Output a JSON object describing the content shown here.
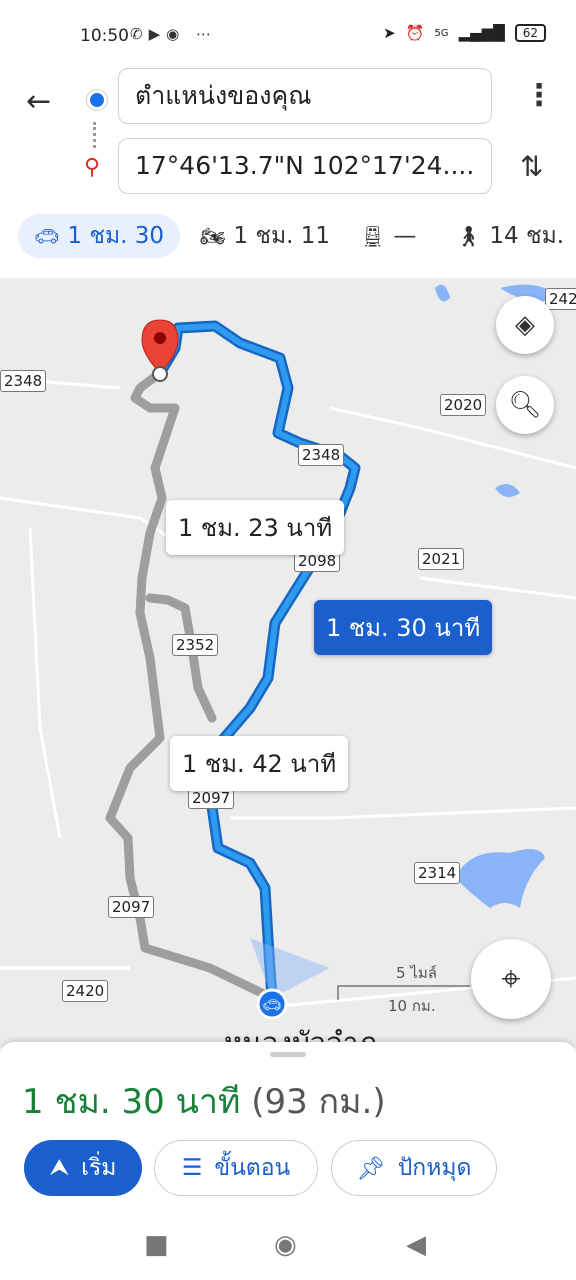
{
  "status": {
    "time": "10:50",
    "battery": "62",
    "network": "5G"
  },
  "header": {
    "origin": "ตำแหน่งของคุณ",
    "destination": "17°46'13.7\"N 102°17'24...."
  },
  "modes": [
    {
      "icon": "car-icon",
      "label": "1 ชม. 30",
      "active": true
    },
    {
      "icon": "motorcycle-icon",
      "label": "1 ชม. 11"
    },
    {
      "icon": "transit-icon",
      "label": "—"
    },
    {
      "icon": "walk-icon",
      "label": "14 ชม."
    }
  ],
  "map": {
    "road_labels": [
      "2348",
      "2020",
      "2348",
      "2021",
      "2098",
      "2352",
      "2097",
      "2314",
      "2097",
      "2420",
      "242"
    ],
    "route_times": {
      "alt1": "1 ชม. 23 นาที",
      "selected": "1 ชม. 30 นาที",
      "alt2": "1 ชม. 42 นาที"
    },
    "scale": {
      "miles": "5 ไมล์",
      "km": "10 กม."
    },
    "town": "หนองบัวลำภู"
  },
  "sheet": {
    "duration": "1 ชม. 30 นาที",
    "distance": "(93 กม.)",
    "start_label": "เริ่ม",
    "steps_label": "ขั้นตอน",
    "pin_label": "ปักหมุด"
  },
  "colors": {
    "route": "#1a73e8",
    "alt_route": "#a6a6a6",
    "accent": "#1a5fcc",
    "duration_green": "#188038"
  }
}
